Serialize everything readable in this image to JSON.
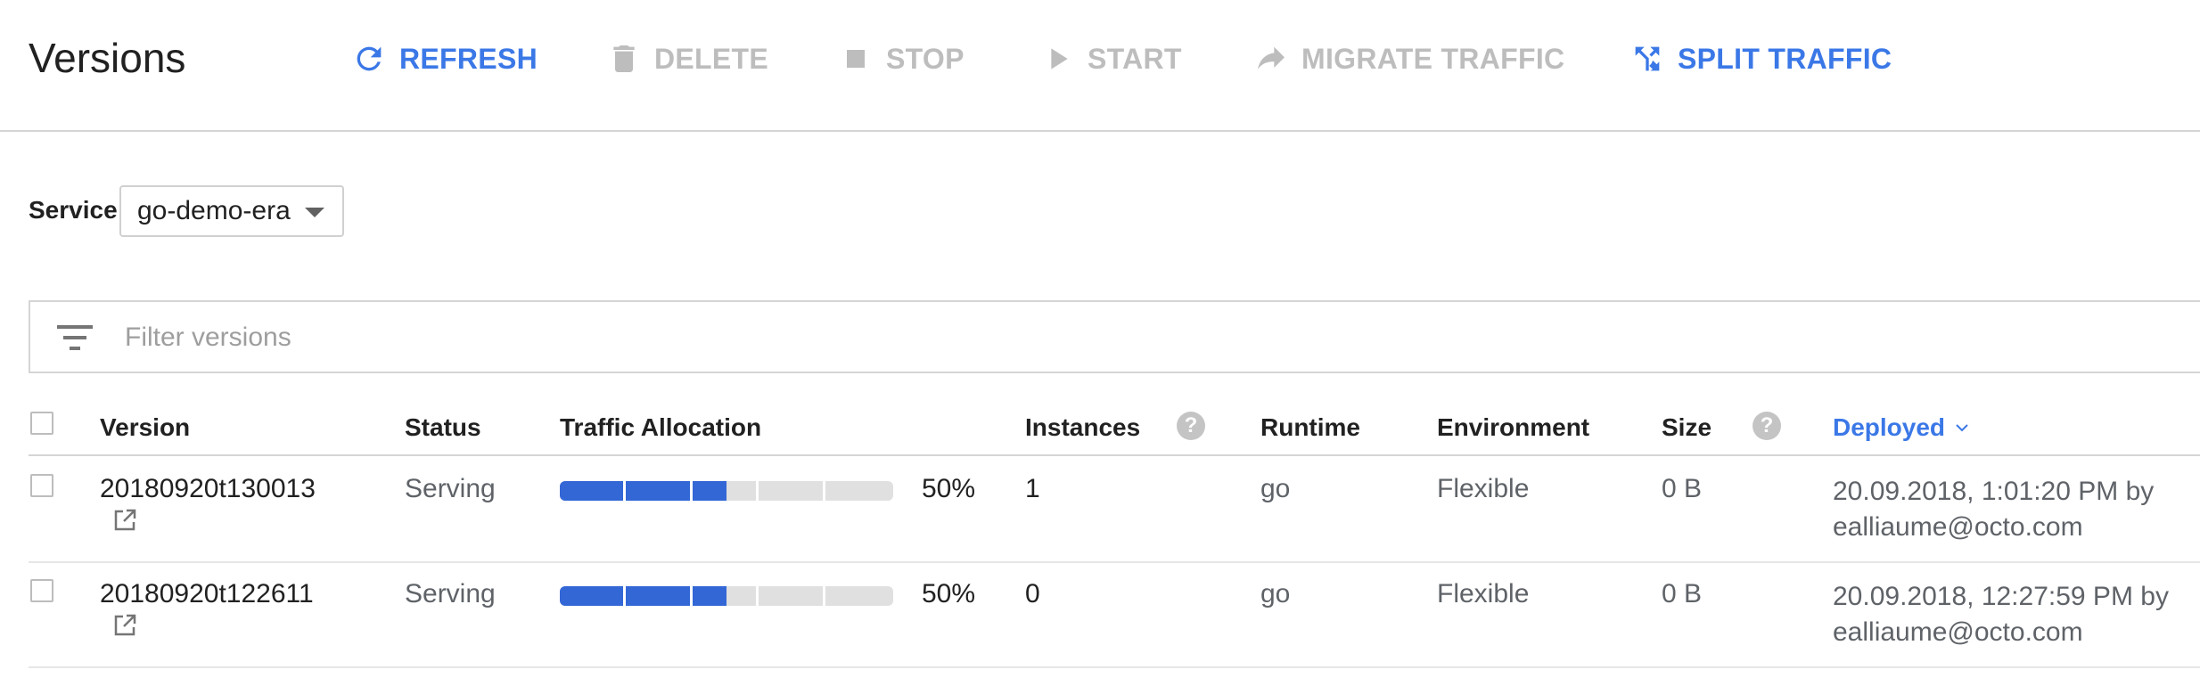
{
  "page": {
    "title": "Versions"
  },
  "toolbar": {
    "buttons": [
      {
        "label": "REFRESH",
        "icon": "refresh-icon",
        "enabled": true
      },
      {
        "label": "DELETE",
        "icon": "trash-icon",
        "enabled": false
      },
      {
        "label": "STOP",
        "icon": "stop-icon",
        "enabled": false
      },
      {
        "label": "START",
        "icon": "play-icon",
        "enabled": false
      },
      {
        "label": "MIGRATE TRAFFIC",
        "icon": "forward-arrow-icon",
        "enabled": false
      },
      {
        "label": "SPLIT TRAFFIC",
        "icon": "split-icon",
        "enabled": true
      }
    ]
  },
  "service": {
    "label": "Service",
    "selected": "go-demo-era"
  },
  "filter": {
    "placeholder": "Filter versions",
    "value": ""
  },
  "table": {
    "headers": {
      "version": "Version",
      "status": "Status",
      "traffic": "Traffic Allocation",
      "instances": "Instances",
      "runtime": "Runtime",
      "environment": "Environment",
      "size": "Size",
      "deployed": "Deployed"
    },
    "help_glyph": "?",
    "sort": {
      "column": "deployed",
      "direction": "descending"
    },
    "rows": [
      {
        "version": "20180920t130013",
        "status": "Serving",
        "traffic_percent": "50%",
        "traffic_fraction": 0.5,
        "instances": "1",
        "runtime": "go",
        "environment": "Flexible",
        "size": "0 B",
        "deployed_line1": "20.09.2018, 1:01:20 PM by",
        "deployed_line2": "ealliaume@octo.com",
        "checked": false
      },
      {
        "version": "20180920t122611",
        "status": "Serving",
        "traffic_percent": "50%",
        "traffic_fraction": 0.5,
        "instances": "0",
        "runtime": "go",
        "environment": "Flexible",
        "size": "0 B",
        "deployed_line1": "20.09.2018, 12:27:59 PM by",
        "deployed_line2": "ealliaume@octo.com",
        "checked": false
      }
    ]
  },
  "colors": {
    "accent": "#3b78e7",
    "disabled": "#bdbdbd",
    "bar_fill": "#3367d6",
    "bar_track": "#e0e0e0"
  }
}
